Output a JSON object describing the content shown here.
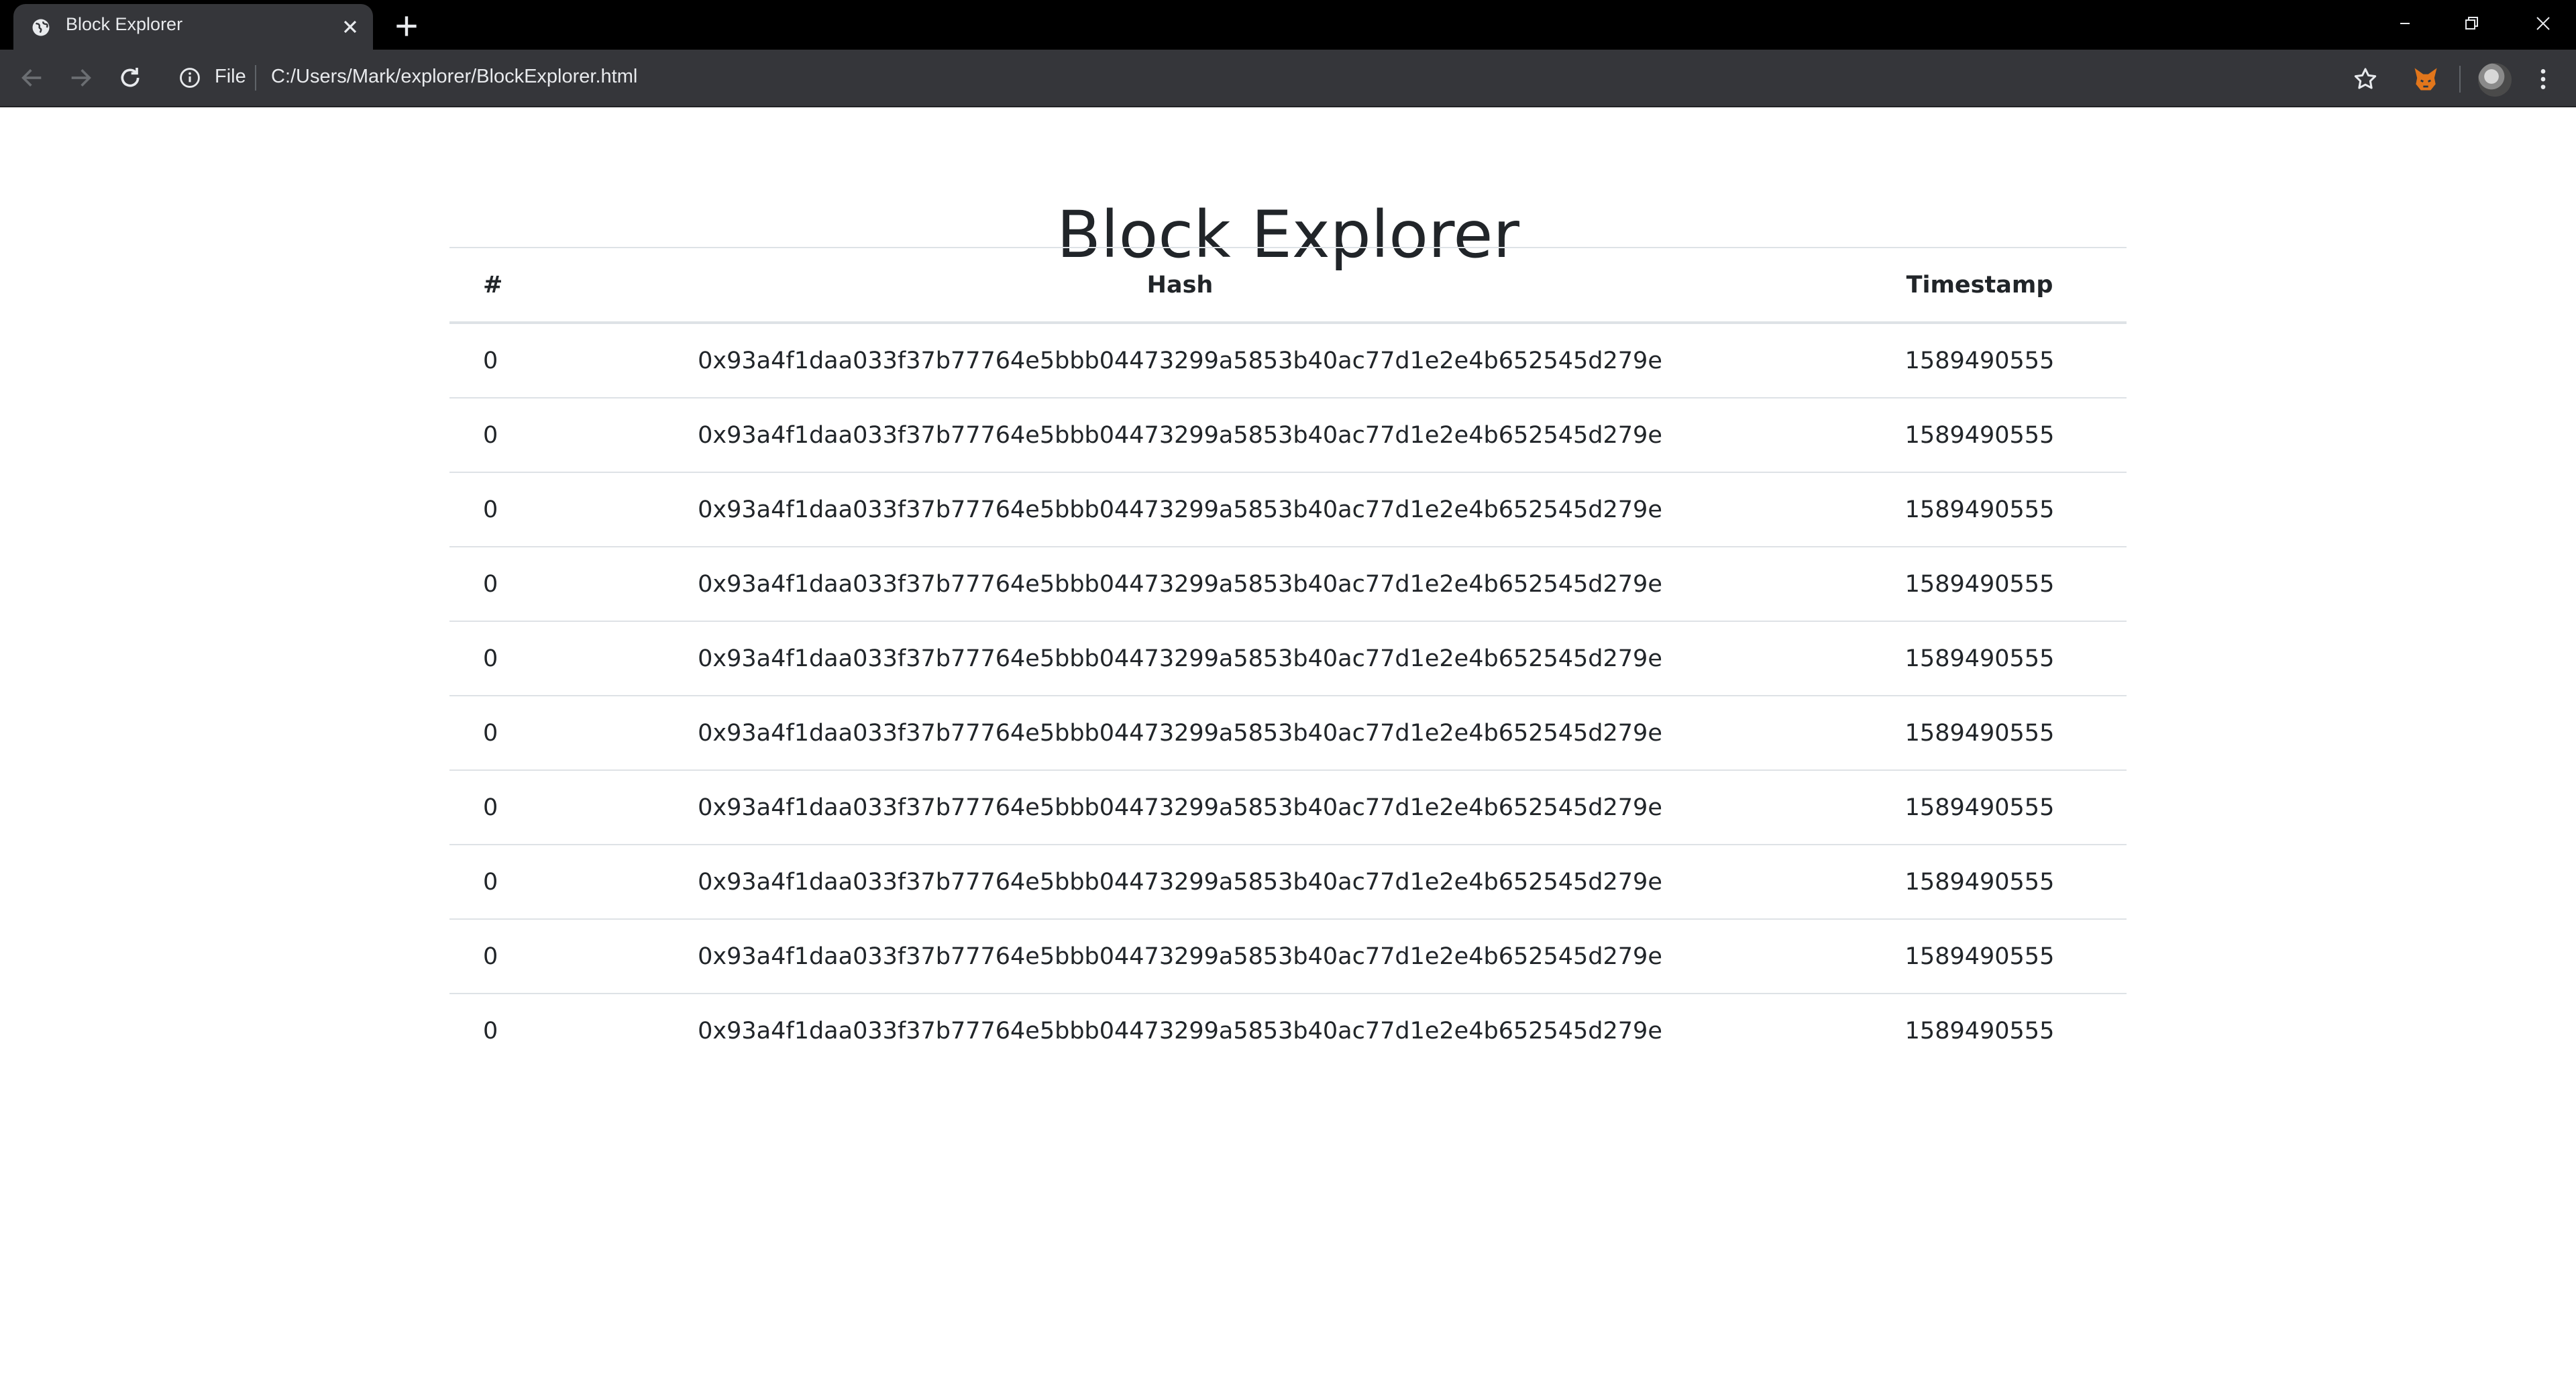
{
  "browser": {
    "tab_title": "Block Explorer",
    "address": {
      "scheme_label": "File",
      "url": "C:/Users/Mark/explorer/BlockExplorer.html"
    },
    "icons": {
      "tab_favicon": "globe-icon",
      "tab_close": "close-icon",
      "new_tab": "plus-icon",
      "back": "arrow-left-icon",
      "forward": "arrow-right-icon",
      "reload": "reload-icon",
      "info": "info-icon",
      "bookmark": "star-icon",
      "extension": "fox-icon",
      "menu": "kebab-menu-icon"
    },
    "colors": {
      "titlebar": "#000000",
      "toolbar": "#35363a",
      "text": "#e8eaed"
    }
  },
  "page": {
    "title": "Block Explorer",
    "table": {
      "headers": {
        "number": "#",
        "hash": "Hash",
        "timestamp": "Timestamp"
      },
      "rows": [
        {
          "number": "0",
          "hash": "0x93a4f1daa033f37b77764e5bbb04473299a5853b40ac77d1e2e4b652545d279e",
          "timestamp": "1589490555"
        },
        {
          "number": "0",
          "hash": "0x93a4f1daa033f37b77764e5bbb04473299a5853b40ac77d1e2e4b652545d279e",
          "timestamp": "1589490555"
        },
        {
          "number": "0",
          "hash": "0x93a4f1daa033f37b77764e5bbb04473299a5853b40ac77d1e2e4b652545d279e",
          "timestamp": "1589490555"
        },
        {
          "number": "0",
          "hash": "0x93a4f1daa033f37b77764e5bbb04473299a5853b40ac77d1e2e4b652545d279e",
          "timestamp": "1589490555"
        },
        {
          "number": "0",
          "hash": "0x93a4f1daa033f37b77764e5bbb04473299a5853b40ac77d1e2e4b652545d279e",
          "timestamp": "1589490555"
        },
        {
          "number": "0",
          "hash": "0x93a4f1daa033f37b77764e5bbb04473299a5853b40ac77d1e2e4b652545d279e",
          "timestamp": "1589490555"
        },
        {
          "number": "0",
          "hash": "0x93a4f1daa033f37b77764e5bbb04473299a5853b40ac77d1e2e4b652545d279e",
          "timestamp": "1589490555"
        },
        {
          "number": "0",
          "hash": "0x93a4f1daa033f37b77764e5bbb04473299a5853b40ac77d1e2e4b652545d279e",
          "timestamp": "1589490555"
        },
        {
          "number": "0",
          "hash": "0x93a4f1daa033f37b77764e5bbb04473299a5853b40ac77d1e2e4b652545d279e",
          "timestamp": "1589490555"
        },
        {
          "number": "0",
          "hash": "0x93a4f1daa033f37b77764e5bbb04473299a5853b40ac77d1e2e4b652545d279e",
          "timestamp": "1589490555"
        }
      ]
    }
  }
}
